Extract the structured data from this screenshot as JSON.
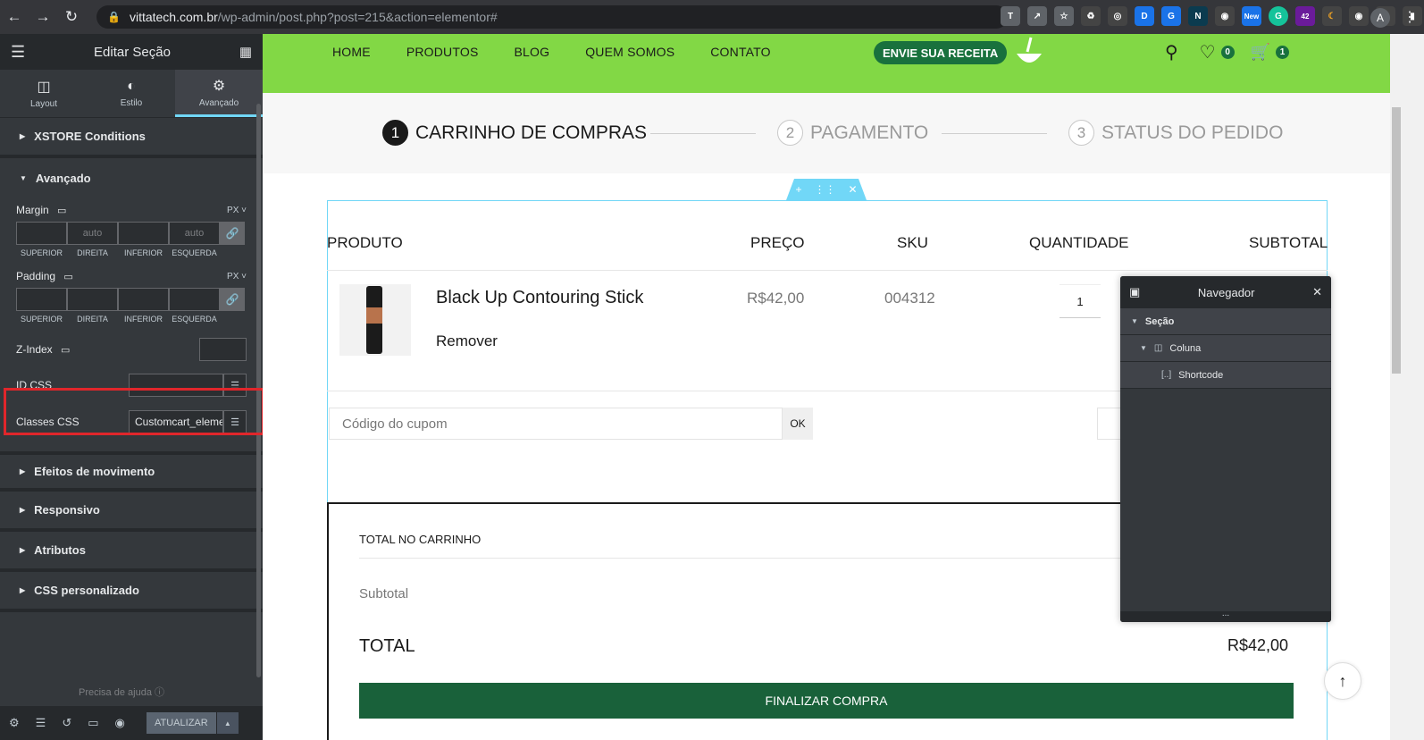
{
  "browser": {
    "url_host": "vittatech.com.br",
    "url_path": "/wp-admin/post.php?post=215&action=elementor#",
    "ext_badge_42": "42",
    "ext_badge_new": "New",
    "avatar_letter": "A"
  },
  "panel": {
    "title": "Editar Seção",
    "tabs": [
      {
        "label": "Layout"
      },
      {
        "label": "Estilo"
      },
      {
        "label": "Avançado"
      }
    ],
    "sections": {
      "xstore": "XSTORE Conditions",
      "avancado": "Avançado",
      "efeitos": "Efeitos de movimento",
      "responsivo": "Responsivo",
      "atributos": "Atributos",
      "css": "CSS personalizado"
    },
    "margin": {
      "label": "Margin",
      "unit": "PX",
      "top": "",
      "right": "auto",
      "bottom": "",
      "left": "auto"
    },
    "padding": {
      "label": "Padding",
      "unit": "PX"
    },
    "dim_labels": [
      "SUPERIOR",
      "DIREITA",
      "INFERIOR",
      "ESQUERDA"
    ],
    "zindex_label": "Z-Index",
    "idcss_label": "ID CSS",
    "classes_label": "Classes CSS",
    "classes_value": "Customcart_element",
    "help": "Precisa de ajuda",
    "update_label": "ATUALIZAR"
  },
  "site": {
    "menu": [
      "HOME",
      "PRODUTOS",
      "BLOG",
      "QUEM SOMOS",
      "CONTATO"
    ],
    "cta": "ENVIE SUA RECEITA",
    "wishlist_count": "0",
    "cart_count": "1",
    "steps": [
      {
        "num": "1",
        "label": "CARRINHO DE COMPRAS"
      },
      {
        "num": "2",
        "label": "PAGAMENTO"
      },
      {
        "num": "3",
        "label": "STATUS DO PEDIDO"
      }
    ],
    "table_headers": {
      "produto": "PRODUTO",
      "preco": "PREÇO",
      "sku": "SKU",
      "quantidade": "QUANTIDADE",
      "subtotal": "SUBTOTAL"
    },
    "item": {
      "name": "Black Up Contouring Stick",
      "remove": "Remover",
      "price": "R$42,00",
      "sku": "004312",
      "qty": "1"
    },
    "coupon_placeholder": "Código do cupom",
    "ok": "OK",
    "totals_title": "TOTAL NO CARRINHO",
    "subtotal_label": "Subtotal",
    "total_label": "TOTAL",
    "total_value": "R$42,00",
    "checkout": "FINALIZAR COMPRA"
  },
  "navigator": {
    "title": "Navegador",
    "items": [
      {
        "label": "Seção"
      },
      {
        "label": "Coluna"
      },
      {
        "label": "Shortcode"
      }
    ],
    "footer": "..."
  },
  "colors": {
    "header_green": "#82d845",
    "brand_green": "#19713d",
    "editor_dark": "#34383c",
    "editor_accent": "#71d7f7",
    "highlight_red": "#e0262b"
  }
}
